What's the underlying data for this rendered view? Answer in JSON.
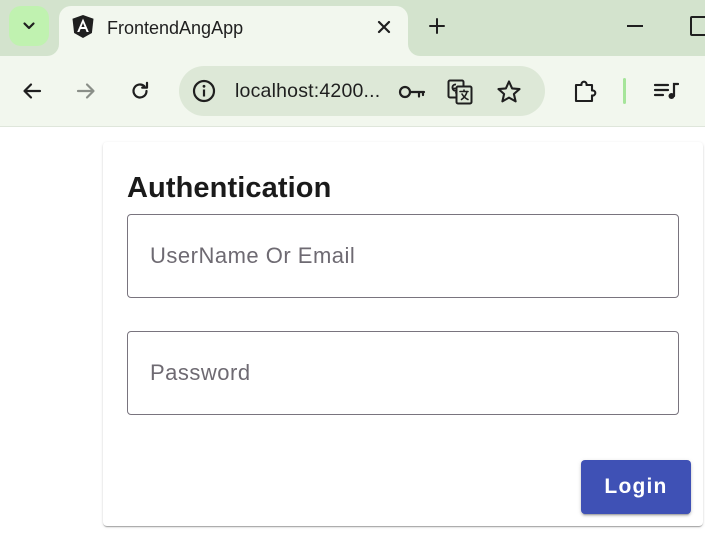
{
  "browser": {
    "tab": {
      "title": "FrontendAngApp",
      "favicon_icon": "angular-logo-icon"
    },
    "address_bar": {
      "url": "localhost:4200..."
    },
    "icons": {
      "tab_search": "chevron-down-icon",
      "tab_close": "close-icon",
      "new_tab": "plus-icon",
      "minimize": "minimize-icon",
      "maximize": "maximize-icon",
      "back": "back-arrow-icon",
      "forward": "forward-arrow-icon",
      "reload": "reload-icon",
      "site_info": "info-icon",
      "password_key": "key-icon",
      "translate": "translate-icon",
      "bookmark": "star-icon",
      "extensions": "puzzle-icon",
      "media": "media-queue-icon"
    },
    "colors": {
      "tabstrip": "#d3e3cd",
      "toolbar": "#f2f7ee",
      "omnibox": "#dde8d7"
    }
  },
  "login_card": {
    "title": "Authentication",
    "username_field": {
      "placeholder": "UserName Or Email",
      "value": ""
    },
    "password_field": {
      "placeholder": "Password",
      "value": ""
    },
    "login_button_label": "Login",
    "accent_color": "#3f51b5"
  }
}
